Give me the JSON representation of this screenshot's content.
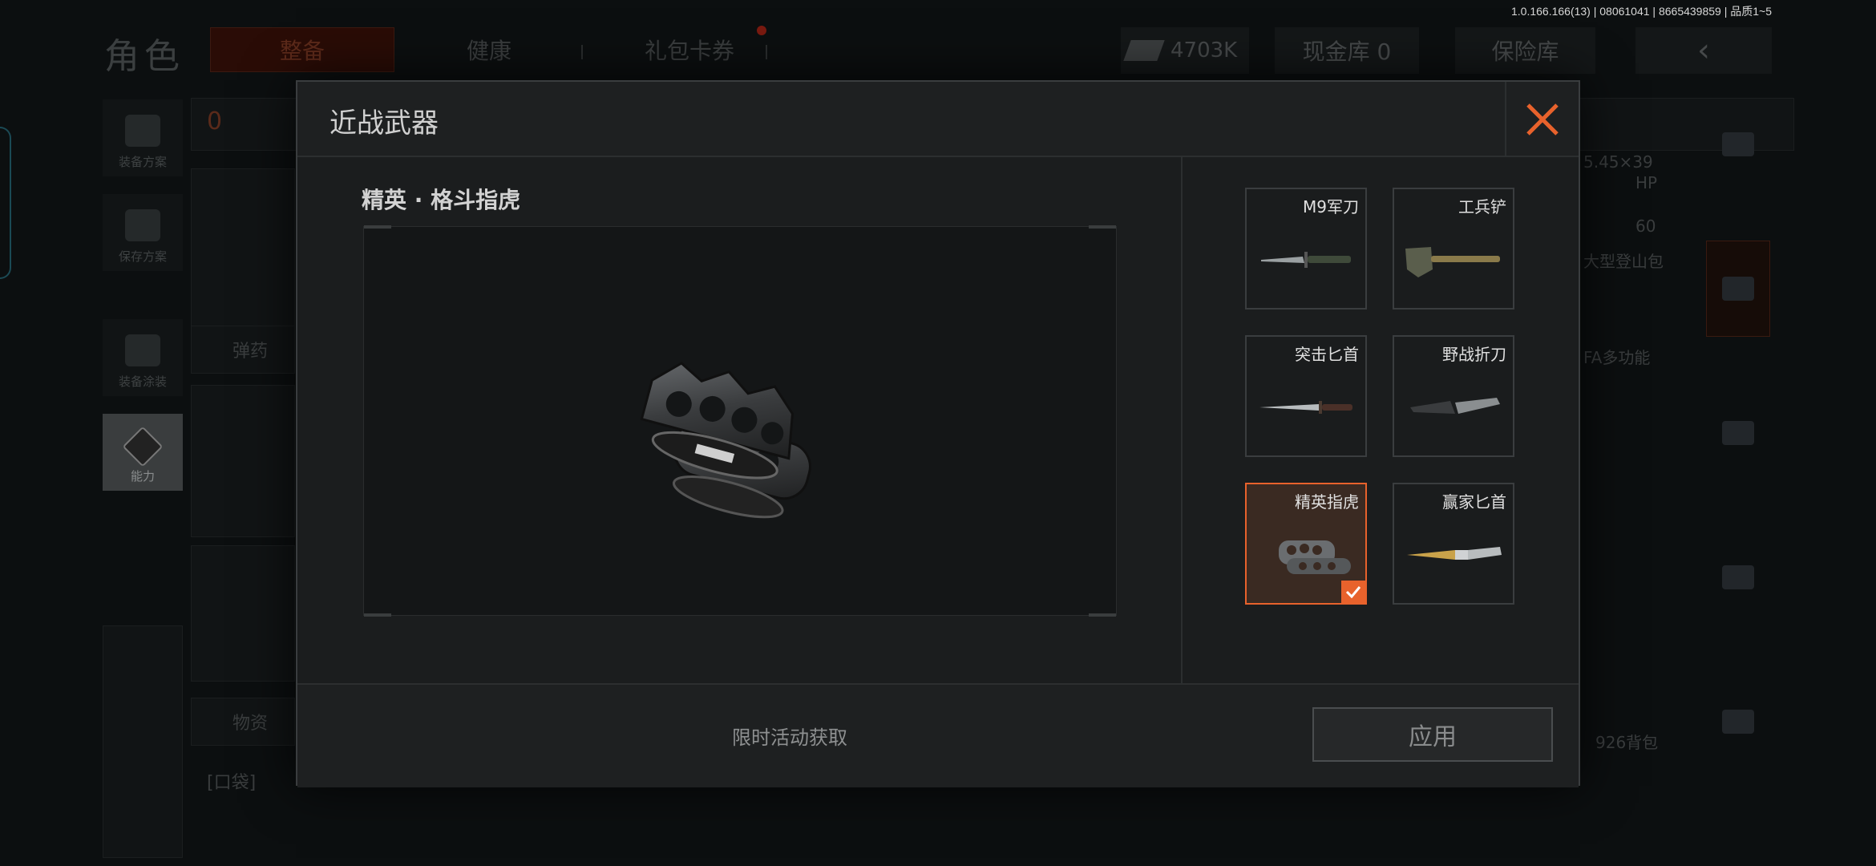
{
  "version": "1.0.166.166(13) | 08061041 | 8665439859 | 品质1~5",
  "background": {
    "title": "角色",
    "tabs": [
      "整备",
      "健康",
      "礼包卡券"
    ],
    "currency": "4703K",
    "cash_vault": "现金库 0",
    "safe": "保险库",
    "side_items": [
      "装备方案",
      "保存方案",
      "装备涂装",
      "能力"
    ],
    "panel_labels": {
      "count": "0",
      "ammo": "弹药",
      "supplies": "物资",
      "pocket": "[口袋]",
      "caliber": "5.45×39",
      "hp": "HP",
      "hp_value": "60",
      "backpack1": "大型登山包",
      "multi": "FA多功能",
      "backpack2": "926背包"
    }
  },
  "modal": {
    "title": "近战武器",
    "selected_name": "精英 · 格斗指虎",
    "footer_note": "限时活动获取",
    "apply_label": "应用",
    "weapons": [
      {
        "label": "M9军刀",
        "icon": "knife-icon"
      },
      {
        "label": "工兵铲",
        "icon": "shovel-icon"
      },
      {
        "label": "突击匕首",
        "icon": "dagger-icon"
      },
      {
        "label": "野战折刀",
        "icon": "folding-knife-icon"
      },
      {
        "label": "精英指虎",
        "icon": "knuckles-icon",
        "selected": true
      },
      {
        "label": "赢家匕首",
        "icon": "gold-dagger-icon"
      }
    ]
  },
  "colors": {
    "accent": "#e8622c",
    "modal_bg": "#1b1d1e",
    "page_bg": "#0c0f10"
  }
}
